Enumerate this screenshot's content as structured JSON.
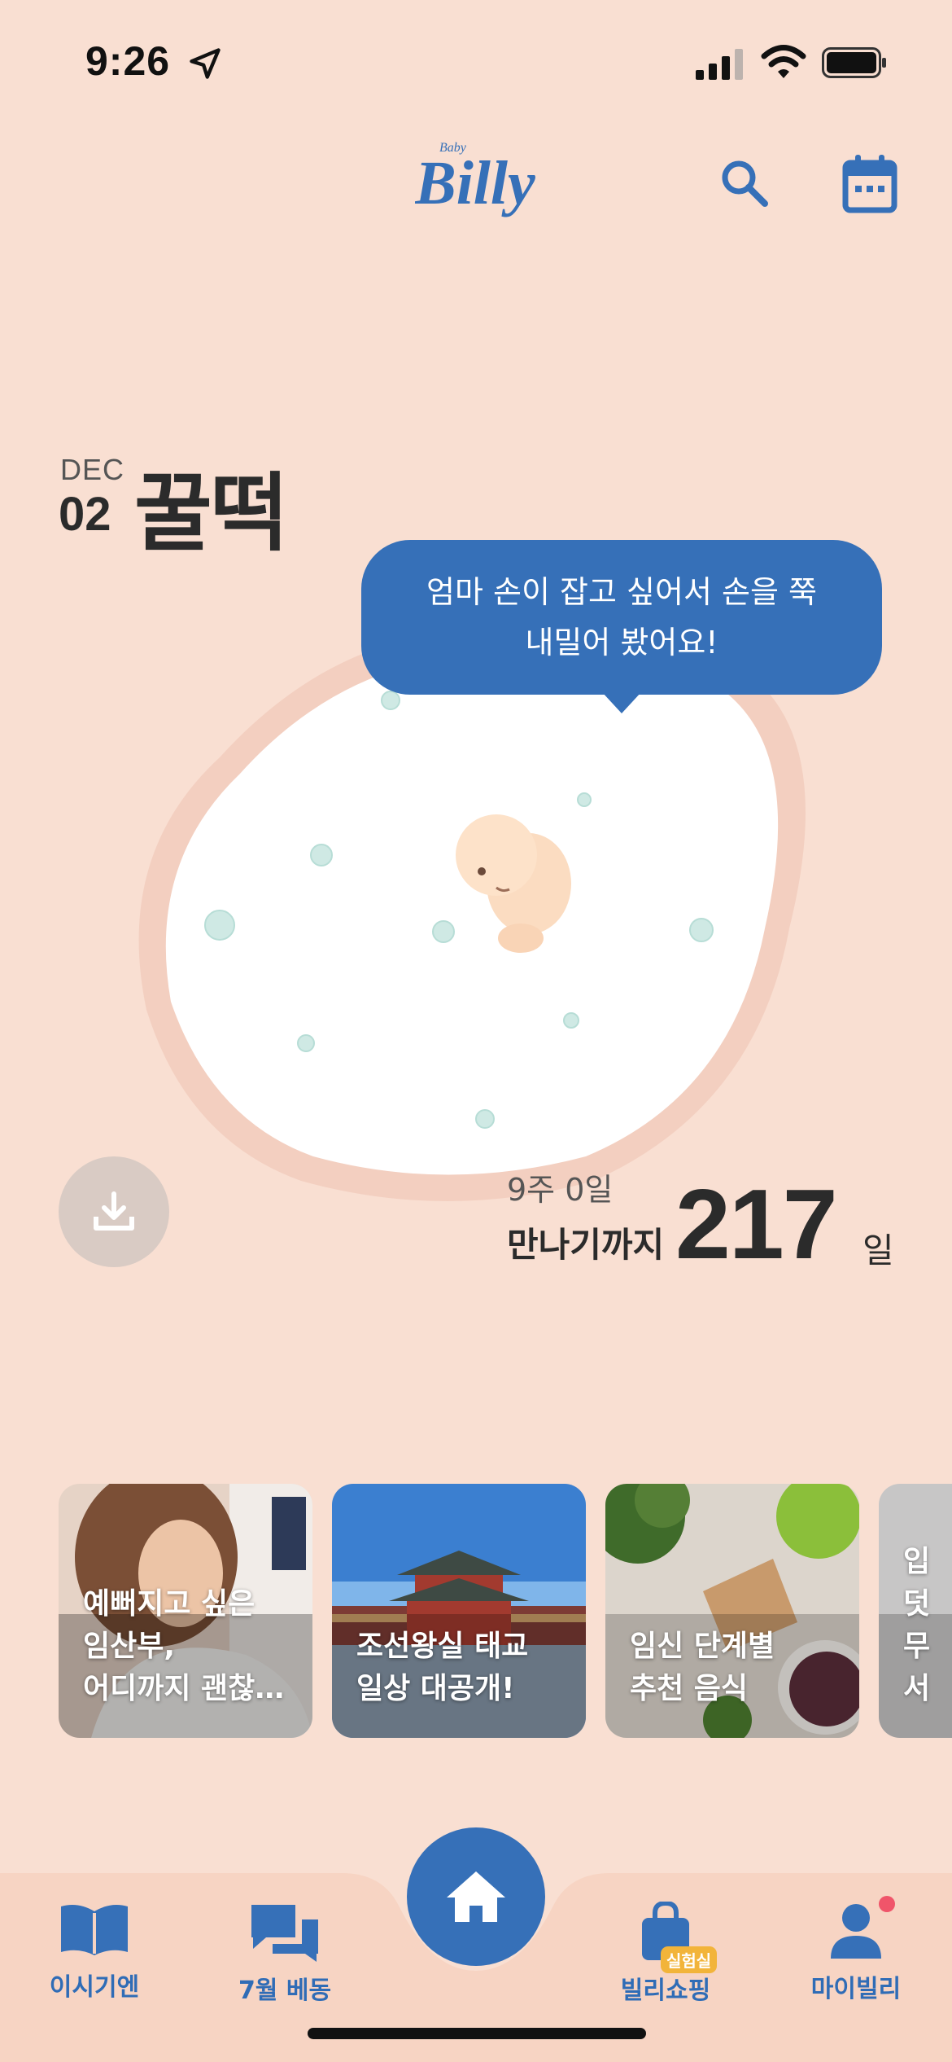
{
  "status_bar": {
    "time": "9:26"
  },
  "header": {
    "logo_small": "Baby",
    "logo_main": "Billy"
  },
  "date": {
    "month": "DEC",
    "day": "02",
    "food": "꿀떡"
  },
  "bubble": {
    "line1": "엄마 손이 잡고 싶어서 손을 쭉",
    "line2": "내밀어 봤어요!"
  },
  "pregnancy": {
    "week_day": "9주 0일",
    "until_label": "만나기까지",
    "days_left": "217",
    "day_unit": "일"
  },
  "cards": [
    {
      "title": "예뻐지고 싶은\n임산부,\n어디까지 괜찮…"
    },
    {
      "title": "조선왕실 태교\n일상 대공개!"
    },
    {
      "title": "임신 단계별\n추천 음식"
    },
    {
      "title": "입덧\n무서"
    }
  ],
  "nav": {
    "items": [
      {
        "label": "이시기엔",
        "icon": "book-icon"
      },
      {
        "label": "7월 베동",
        "icon": "chat-icon"
      },
      {
        "label": "빌리쇼핑",
        "icon": "shopping-bag-icon",
        "badge": "실험실"
      },
      {
        "label": "마이빌리",
        "icon": "person-icon"
      }
    ],
    "home_icon": "home-icon"
  },
  "colors": {
    "primary": "#3670b8",
    "background": "#f9dfd2",
    "notification": "#f0556a"
  }
}
